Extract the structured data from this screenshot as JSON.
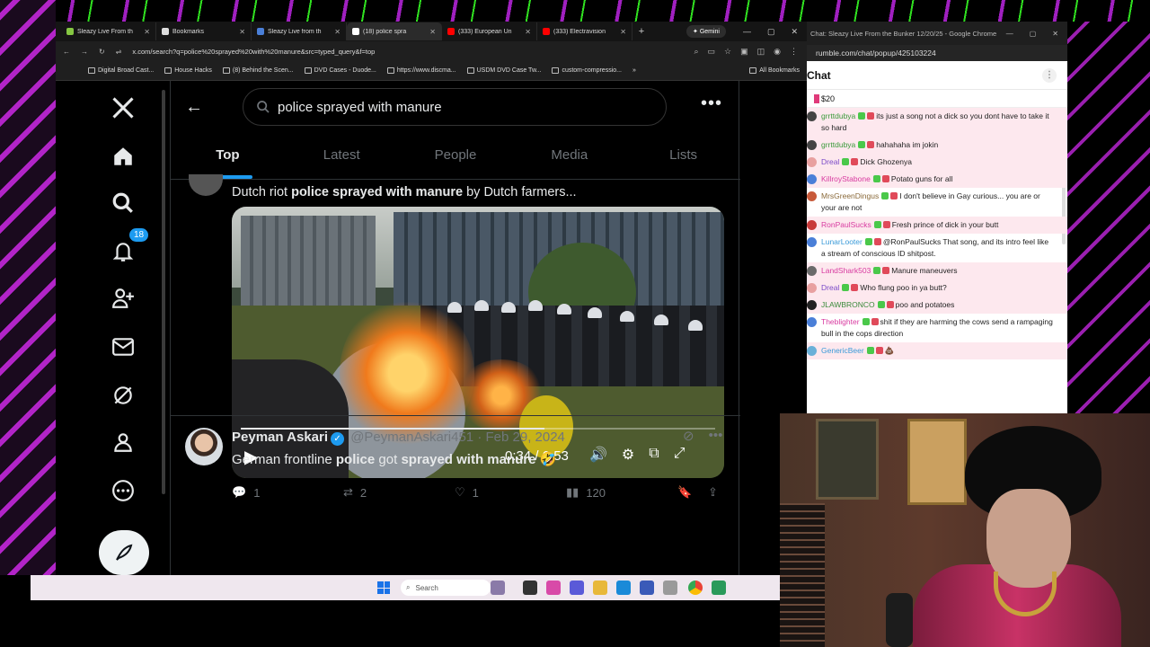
{
  "browser": {
    "tabs": [
      {
        "label": "Sleazy Live From th",
        "icon": "rumble-icon",
        "color": "#85c742"
      },
      {
        "label": "Bookmarks",
        "icon": "star-icon",
        "color": "#dddddd"
      },
      {
        "label": "Sleazy Live from th",
        "icon": "r-icon",
        "color": "#4a7fd8"
      },
      {
        "label": "(18) police spra",
        "icon": "x-icon",
        "color": "#ffffff"
      },
      {
        "label": "(333) European Un",
        "icon": "youtube-icon",
        "color": "#ff0000"
      },
      {
        "label": "(333) Electravision",
        "icon": "youtube-icon",
        "color": "#ff0000"
      }
    ],
    "gemini_label": "Gemini",
    "url": "x.com/search?q=police%20sprayed%20with%20manure&src=typed_query&f=top",
    "bookmarks": [
      "Digital Broad Cast...",
      "House Hacks",
      "(8) Behind the Scen...",
      "DVD Cases - Duode...",
      "https://www.discma...",
      "USDM DVD Case Tw...",
      "custom-compressio..."
    ],
    "all_bookmarks": "All Bookmarks"
  },
  "twitter": {
    "notification_count": "18",
    "search_query": "police sprayed with manure",
    "tabs": [
      "Top",
      "Latest",
      "People",
      "Media",
      "Lists"
    ],
    "tweet1": {
      "text_before": "Dutch riot ",
      "text_bold": "police sprayed with manure",
      "text_after": " by Dutch farmers...",
      "video_time": "0:34 / 0:53",
      "video_progress": 0.64,
      "replies": "1",
      "retweets": "2",
      "likes": "1",
      "views": "120"
    },
    "tweet2": {
      "name": "Peyman Askari",
      "handle": "@PeymanAskari451",
      "date": "Feb 29, 2024",
      "text_a": "German frontline ",
      "text_b": "police",
      "text_c": " got ",
      "text_d": "sprayed with manure",
      "emoji": "🤣"
    }
  },
  "taskbar": {
    "search_label": "Search"
  },
  "chat": {
    "window_title": "Chat: Sleazy Live From the Bunker 12/20/25 - Google Chrome",
    "url": "rumble.com/chat/popup/425103224",
    "header": "Chat",
    "rant_amount": "$20",
    "messages": [
      {
        "user": "grrttdubya",
        "color": "#3a9a3a",
        "text": "its just a song not a dick so you dont have to take it so hard",
        "av": "#444444",
        "tint": true
      },
      {
        "user": "grrttdubya",
        "color": "#3a9a3a",
        "text": "hahahaha im jokin",
        "av": "#444444",
        "tint": true
      },
      {
        "user": "Dreal",
        "color": "#7a4ac8",
        "text": "Dick Ghozenya",
        "av": "#e8a0a0",
        "tint": true
      },
      {
        "user": "KillroyStabone",
        "color": "#d83aa0",
        "text": "Potato guns for all",
        "av": "#4a7fd8",
        "tint": true
      },
      {
        "user": "MrsGreenDingus",
        "color": "#8a6a3a",
        "text": "I don't believe in Gay curious... you are or your are not",
        "av": "#c85a3a",
        "tint": false
      },
      {
        "user": "RonPaulSucks",
        "color": "#d83aa0",
        "text": "Fresh prince of dick in your butt",
        "av": "#c83a3a",
        "tint": true
      },
      {
        "user": "LunarLooter",
        "color": "#3a9ad8",
        "text": "@RonPaulSucks That song, and its intro feel like a stream of conscious ID shitpost.",
        "av": "#4a7fd8",
        "tint": false
      },
      {
        "user": "LandShark503",
        "color": "#d83aa0",
        "text": "Manure maneuvers",
        "av": "#6a6a6a",
        "tint": true
      },
      {
        "user": "Dreal",
        "color": "#7a4ac8",
        "text": "Who flung poo in ya butt?",
        "av": "#e8a0a0",
        "tint": true
      },
      {
        "user": "JLAWBRONCO",
        "color": "#3a8a3a",
        "text": "poo and potatoes",
        "av": "#222222",
        "tint": true
      },
      {
        "user": "Theblighter",
        "color": "#d83aa0",
        "text": "shit if they are harming the cows send a rampaging bull in the cops direction",
        "av": "#4a7fd8",
        "tint": false
      },
      {
        "user": "GenericBeer",
        "color": "#3a9ad8",
        "text": "💩",
        "av": "#6ab0d8",
        "tint": true
      }
    ]
  }
}
